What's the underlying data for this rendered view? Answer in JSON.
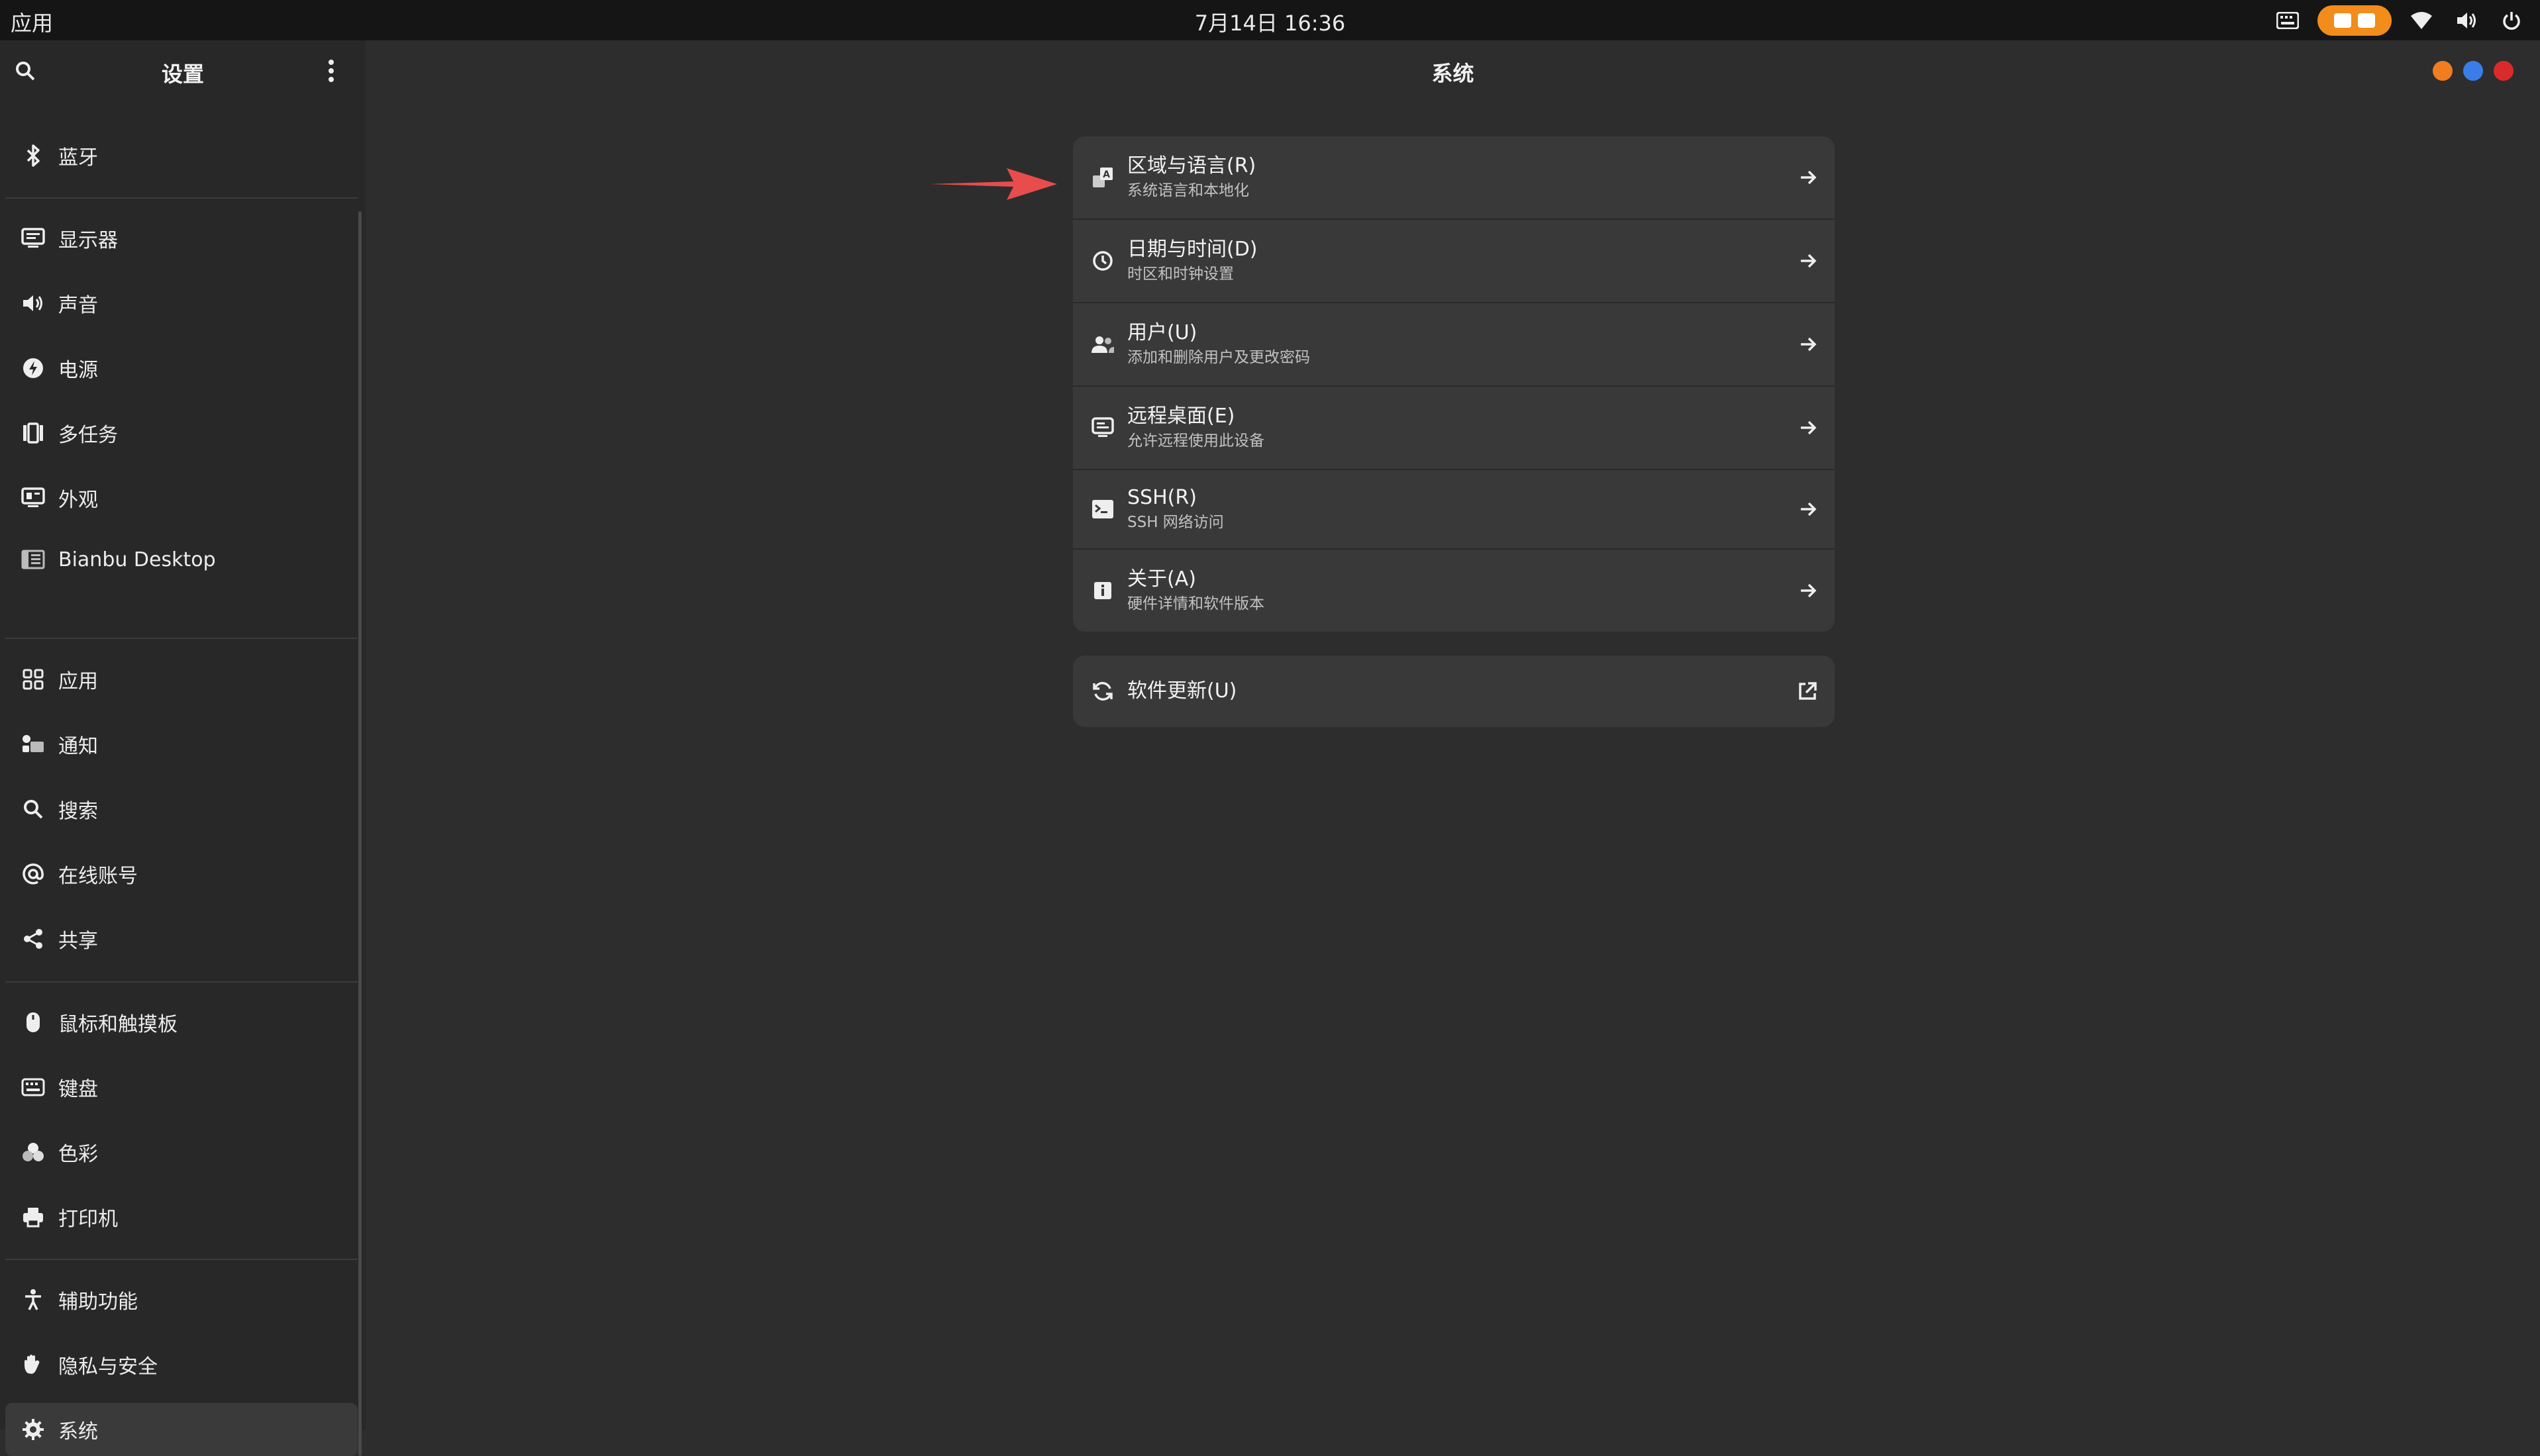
{
  "topbar": {
    "apps_label": "应用",
    "clock": "7月14日  16:36",
    "pill_color": "#f28c1a"
  },
  "sidebar": {
    "title": "设置",
    "items": [
      {
        "label": "蓝牙",
        "icon": "bluetooth-icon"
      },
      {
        "label": "显示器",
        "icon": "display-icon"
      },
      {
        "label": "声音",
        "icon": "speaker-icon"
      },
      {
        "label": "电源",
        "icon": "power-icon"
      },
      {
        "label": "多任务",
        "icon": "multitasking-icon"
      },
      {
        "label": "外观",
        "icon": "appearance-icon"
      },
      {
        "label": "Bianbu Desktop",
        "icon": "desktop-icon"
      },
      {
        "label": "应用",
        "icon": "apps-grid-icon"
      },
      {
        "label": "通知",
        "icon": "notifications-icon"
      },
      {
        "label": "搜索",
        "icon": "search-icon"
      },
      {
        "label": "在线账号",
        "icon": "at-icon"
      },
      {
        "label": "共享",
        "icon": "share-icon"
      },
      {
        "label": "鼠标和触摸板",
        "icon": "mouse-icon"
      },
      {
        "label": "键盘",
        "icon": "keyboard-icon"
      },
      {
        "label": "色彩",
        "icon": "color-icon"
      },
      {
        "label": "打印机",
        "icon": "printer-icon"
      },
      {
        "label": "辅助功能",
        "icon": "accessibility-icon"
      },
      {
        "label": "隐私与安全",
        "icon": "privacy-hand-icon"
      },
      {
        "label": "系统",
        "icon": "gear-icon",
        "active": true
      }
    ]
  },
  "main": {
    "title": "系统",
    "window_buttons": [
      "#f07d1f",
      "#3b7de6",
      "#d92b2b"
    ],
    "rows": [
      {
        "title": "区域与语言(R)",
        "subtitle": "系统语言和本地化",
        "icon": "region-language-icon"
      },
      {
        "title": "日期与时间(D)",
        "subtitle": "时区和时钟设置",
        "icon": "clock-icon"
      },
      {
        "title": "用户(U)",
        "subtitle": "添加和删除用户及更改密码",
        "icon": "users-icon"
      },
      {
        "title": "远程桌面(E)",
        "subtitle": "允许远程使用此设备",
        "icon": "remote-desktop-icon"
      },
      {
        "title": "SSH(R)",
        "subtitle": "SSH 网络访问",
        "icon": "terminal-icon"
      },
      {
        "title": "关于(A)",
        "subtitle": "硬件详情和软件版本",
        "icon": "info-icon"
      }
    ],
    "update": {
      "title": "软件更新(U)",
      "icon": "refresh-icon"
    },
    "annotation_color": "#e84c4c"
  }
}
